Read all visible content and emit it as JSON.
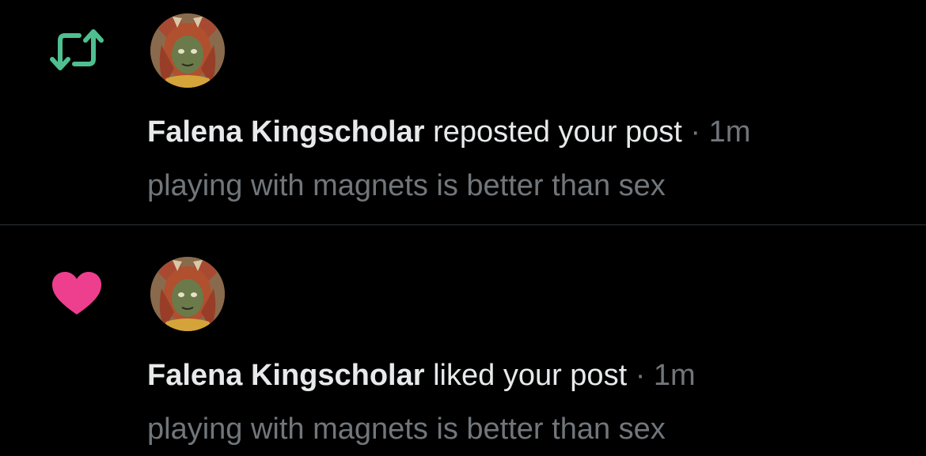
{
  "colors": {
    "background": "#000000",
    "divider": "#2f3336",
    "primary_text": "#e7e9ea",
    "secondary_text": "#71767b",
    "repost_green": "#00ba7c",
    "like_pink": "#f91880"
  },
  "notifications": [
    {
      "type_icon": "repost-icon",
      "user_name": "Falena Kingscholar",
      "action": "reposted your post",
      "separator": "·",
      "time": "1m",
      "post_text": "playing with magnets is better than sex"
    },
    {
      "type_icon": "heart-icon",
      "user_name": "Falena Kingscholar",
      "action": "liked your post",
      "separator": "·",
      "time": "1m",
      "post_text": "playing with magnets is better than sex"
    }
  ]
}
